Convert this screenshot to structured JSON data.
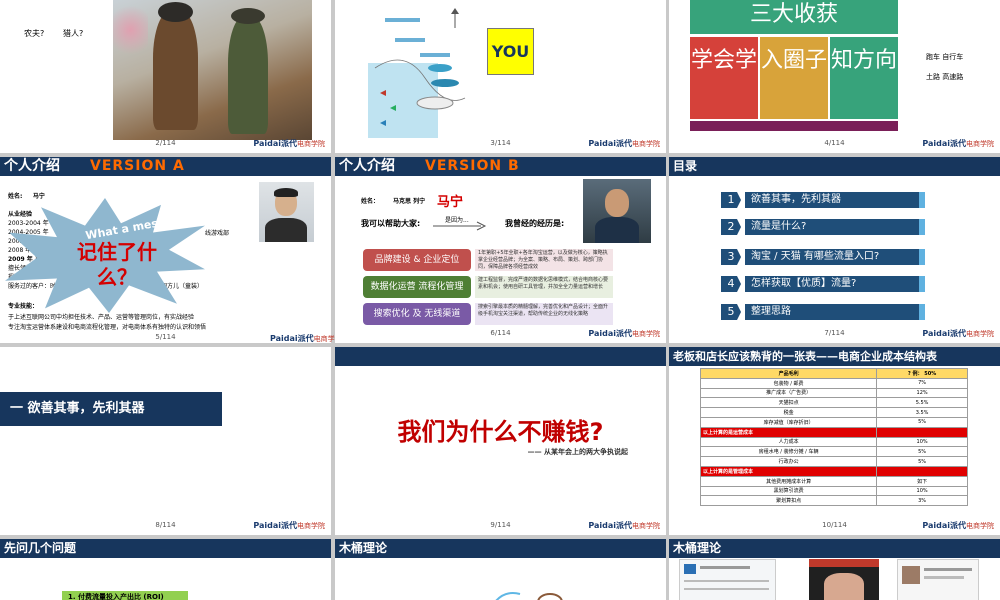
{
  "slides": [
    {
      "page": "2/114",
      "labels": [
        "农夫?",
        "猎人?"
      ]
    },
    {
      "page": "3/114",
      "you_label": "YOU"
    },
    {
      "page": "4/114",
      "title": "三大收获",
      "cells": [
        "学会学",
        "入圈子",
        "知方向"
      ],
      "side_lines": [
        "跑车 自行车",
        "土路 高速路"
      ]
    },
    {
      "page": "5/114",
      "title": "个人介绍",
      "version": "VERSION A",
      "name_label": "姓名:",
      "name": "马宁",
      "exp_label": "从业经验",
      "years": [
        "2003-2004 年",
        "2004-2005 年",
        "2005-2007 年",
        "2008 年",
        "2009 年 正式"
      ],
      "lines_right": [
        "线游戏部",
        "...",
        "乐园方儿（童装）"
      ],
      "skill_label": "擅长领域：运营",
      "other_lines": [
        "授课特点：",
        "服务过的客户：时尚类"
      ],
      "pro_label": "专业技能：",
      "pro_lines": [
        "于上述互联网公司中均担任技术、产品、运营等管理岗位，有实战经验",
        "专注淘宝运营体系建设和电商流程化管理，对电商体系有独特的认识和领悟"
      ],
      "burst_title": "What a mess!",
      "burst_main": "记住了什么？"
    },
    {
      "page": "6/114",
      "title": "个人介绍",
      "version": "VERSION B",
      "name_label": "姓名：",
      "names": "马克思 列宁",
      "real_name": "马宁",
      "help_label": "我可以帮助大家:",
      "arrow_label": "是因为...",
      "exp_label": "我曾经的经历是:",
      "categories": [
        {
          "label": "品牌建设 & 企业定位",
          "desc": "1年第职+5年全职+各年淘宝运营，以及做为核心，策略执掌企业经营品牌；为全案、策略、布局、策划、跨部门协同，保障品牌各项经营成效"
        },
        {
          "label": "数据化运营  流程化管理",
          "desc": "建工程监督，完成严谨的数据化思维模式，结合电商核心要素和机会；使用自研工具管理，并加全全力量运营和增长"
        },
        {
          "label": "搜索优化 及 无线渠道",
          "desc": "搜索引擎最本质的精髓理解，完善优化和产品设计；全面升级手机淘宝关注渠道，帮助传统企业的无线化策略"
        }
      ]
    },
    {
      "page": "7/114",
      "title": "目录",
      "toc": [
        "欲善其事，先利其器",
        "流量是什么?",
        "淘宝 / 天猫 有哪些流量入口?",
        "怎样获取【优质】流量?",
        "整理思路"
      ]
    },
    {
      "page": "8/114",
      "section": "一  欲善其事，先利其器"
    },
    {
      "page": "9/114",
      "headline": "我们为什么不赚钱?",
      "subline": "—— 从某年会上的两大争执说起"
    },
    {
      "page": "10/114",
      "title": "老板和店长应该熟背的一张表——电商企业成本结构表",
      "table": {
        "headers": [
          "产品毛利",
          "?  例：  50%"
        ],
        "rows": [
          {
            "type": "row",
            "cells": [
              "包装物 / 邮费",
              "7%"
            ]
          },
          {
            "type": "row",
            "cells": [
              "推广成本（广告费）",
              "12%"
            ]
          },
          {
            "type": "row",
            "cells": [
              "天猫扣点",
              "5.5%"
            ]
          },
          {
            "type": "row",
            "cells": [
              "税金",
              "3.5%"
            ]
          },
          {
            "type": "row",
            "cells": [
              "库存减值（库存折旧）",
              "5%"
            ]
          },
          {
            "type": "sec",
            "cells": [
              "以上计算的是运营成本",
              ""
            ]
          },
          {
            "type": "row",
            "cells": [
              "人力成本",
              "10%"
            ]
          },
          {
            "type": "row",
            "cells": [
              "房租水电 / 装修分摊 / 车辆",
              "5%"
            ]
          },
          {
            "type": "row",
            "cells": [
              "行政办公",
              "5%"
            ]
          },
          {
            "type": "sec",
            "cells": [
              "以上计算的是管理成本",
              ""
            ]
          },
          {
            "type": "row",
            "cells": [
              "其他费用摊成本计算",
              "如下"
            ]
          },
          {
            "type": "row",
            "cells": [
              "黑划算引流费",
              "10%"
            ]
          },
          {
            "type": "row",
            "cells": [
              "聚划算扣点",
              "3%"
            ]
          }
        ]
      }
    },
    {
      "title": "先问几个问题",
      "item": "1. 付费流量投入产出比 (ROI)"
    },
    {
      "title": "木桶理论"
    },
    {
      "title": "木桶理论"
    }
  ],
  "logo": {
    "brand": "Paidai",
    "brand2": "派代",
    "sub": "电商学院"
  },
  "colors": {
    "navy": "#17365d",
    "orange": "#ff6a00",
    "red": "#c00000"
  }
}
